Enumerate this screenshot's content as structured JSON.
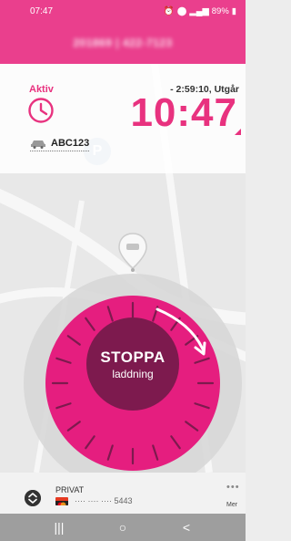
{
  "status_bar": {
    "time": "07:47",
    "battery": "89%"
  },
  "header": {
    "title": "201869 | 422-7123"
  },
  "parking": {
    "status_label": "Aktiv",
    "plate": "ABC123",
    "expiry": "- 2:59:10, Utgår",
    "time": "10:47"
  },
  "map": {
    "parking_marker": "P"
  },
  "action": {
    "title": "STOPPA",
    "subtitle": "laddning"
  },
  "payment": {
    "label": "PRIVAT",
    "card_number": "···· ···· ···· 5443"
  },
  "more": {
    "dots": "•••",
    "label": "Mer"
  },
  "nav": {
    "recents": "|||",
    "home": "○",
    "back": "<"
  },
  "colors": {
    "accent": "#ea3f8d",
    "dark_accent": "#7d1a4e",
    "dial_ring": "#d7d7d7"
  },
  "icons": [
    "clock-icon",
    "car-icon",
    "map-pin-icon",
    "sort-icon",
    "card-icon",
    "more-icon"
  ]
}
